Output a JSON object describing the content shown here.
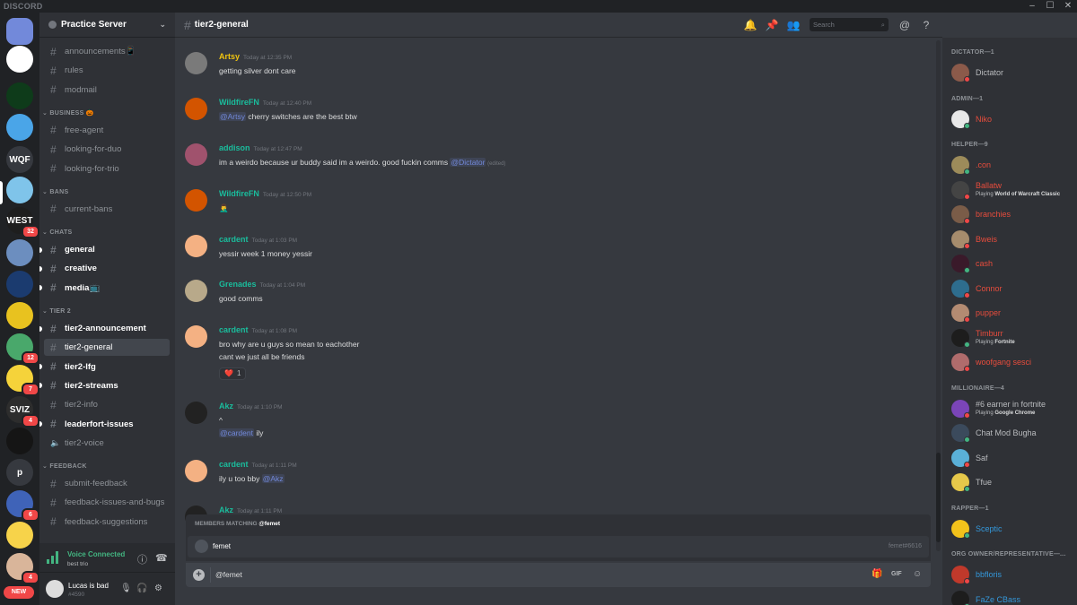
{
  "window": {
    "brand": "DISCORD",
    "controls": [
      "–",
      "☐",
      "✕"
    ]
  },
  "guilds": {
    "items": [
      {
        "label": "",
        "color": "#7289da",
        "badge": ""
      },
      {
        "label": "",
        "color": "#ffffff",
        "badge": ""
      },
      {
        "label": "",
        "color": "#0e3b1a",
        "badge": ""
      },
      {
        "label": "",
        "color": "#4aa5e8",
        "badge": ""
      },
      {
        "label": "WQF",
        "color": "#36393f",
        "badge": ""
      },
      {
        "label": "",
        "color": "#7fc4ea",
        "badge": ""
      },
      {
        "label": "WEST",
        "color": "#1e1e1e",
        "badge": "32"
      },
      {
        "label": "",
        "color": "#6c8ebf",
        "badge": ""
      },
      {
        "label": "",
        "color": "#1b3b6f",
        "badge": ""
      },
      {
        "label": "",
        "color": "#e8c21f",
        "badge": ""
      },
      {
        "label": "",
        "color": "#49a86b",
        "badge": "12"
      },
      {
        "label": "",
        "color": "#f5d33a",
        "badge": "7"
      },
      {
        "label": "SVIZ",
        "color": "#2d2d2d",
        "badge": "4"
      },
      {
        "label": "",
        "color": "#151515",
        "badge": ""
      },
      {
        "label": "p",
        "color": "#36393f",
        "badge": ""
      },
      {
        "label": "",
        "color": "#3f63b8",
        "badge": "6"
      },
      {
        "label": "",
        "color": "#f7d34a",
        "badge": ""
      },
      {
        "label": "",
        "color": "#d9b59a",
        "badge": "4"
      }
    ],
    "new_badge": "NEW"
  },
  "server": {
    "name": "Practice Server"
  },
  "channels": {
    "items": [
      {
        "type": "text",
        "label": "announcements📱",
        "state": "read"
      },
      {
        "type": "text",
        "label": "rules",
        "state": "read"
      },
      {
        "type": "text",
        "label": "modmail",
        "state": "read"
      },
      {
        "type": "category",
        "label": "BUSINESS 🎃"
      },
      {
        "type": "text",
        "label": "free-agent",
        "state": "read"
      },
      {
        "type": "text",
        "label": "looking-for-duo",
        "state": "read"
      },
      {
        "type": "text",
        "label": "looking-for-trio",
        "state": "read"
      },
      {
        "type": "category",
        "label": "BANS"
      },
      {
        "type": "text",
        "label": "current-bans",
        "state": "read"
      },
      {
        "type": "category",
        "label": "CHATS"
      },
      {
        "type": "text",
        "label": "general",
        "state": "unread"
      },
      {
        "type": "text",
        "label": "creative",
        "state": "unread"
      },
      {
        "type": "text",
        "label": "media📺",
        "state": "unread"
      },
      {
        "type": "category",
        "label": "TIER 2"
      },
      {
        "type": "text",
        "label": "tier2-announcement",
        "state": "unread"
      },
      {
        "type": "text",
        "label": "tier2-general",
        "state": "active"
      },
      {
        "type": "text",
        "label": "tier2-lfg",
        "state": "unread"
      },
      {
        "type": "text",
        "label": "tier2-streams",
        "state": "unread"
      },
      {
        "type": "text",
        "label": "tier2-info",
        "state": "read"
      },
      {
        "type": "text",
        "label": "leaderfort-issues",
        "state": "unread"
      },
      {
        "type": "voice",
        "label": "tier2-voice",
        "state": "read"
      },
      {
        "type": "category",
        "label": "FEEDBACK"
      },
      {
        "type": "text",
        "label": "submit-feedback",
        "state": "read"
      },
      {
        "type": "text",
        "label": "feedback-issues-and-bugs",
        "state": "read"
      },
      {
        "type": "text",
        "label": "feedback-suggestions",
        "state": "read"
      }
    ]
  },
  "voice": {
    "status": "Voice Connected",
    "channel": "best trio"
  },
  "user": {
    "name": "Lucas is bad",
    "tag": "#4590"
  },
  "chat": {
    "channel": "tier2-general",
    "search_placeholder": "Search",
    "messages": [
      {
        "author": "Artsy",
        "color": "#f1c40f",
        "time": "Today at 12:35 PM",
        "avatar": "#7a7a7a",
        "lines": [
          [
            {
              "t": "getting silver dont care"
            }
          ]
        ]
      },
      {
        "author": "WildfireFN",
        "color": "#1abc9c",
        "time": "Today at 12:40 PM",
        "avatar": "#d35400",
        "lines": [
          [
            {
              "t": "@Artsy",
              "m": true
            },
            {
              "t": " cherry switches are the best btw"
            }
          ]
        ]
      },
      {
        "author": "addison",
        "color": "#1abc9c",
        "time": "Today at 12:47 PM",
        "avatar": "#a0526d",
        "lines": [
          [
            {
              "t": "im a weirdo because ur buddy said im a weirdo. good fuckin comms "
            },
            {
              "t": "@Dictator",
              "m": true
            },
            {
              "t": " (edited)",
              "e": true
            }
          ]
        ]
      },
      {
        "author": "WildfireFN",
        "color": "#1abc9c",
        "time": "Today at 12:50 PM",
        "avatar": "#d35400",
        "lines": [
          [
            {
              "t": "🤦‍♂️"
            }
          ]
        ]
      },
      {
        "author": "cardent",
        "color": "#1abc9c",
        "time": "Today at 1:03 PM",
        "avatar": "#f4b183",
        "lines": [
          [
            {
              "t": "yessir week 1 money yessir"
            }
          ]
        ]
      },
      {
        "author": "Grenades",
        "color": "#1abc9c",
        "time": "Today at 1:04 PM",
        "avatar": "#b8a98a",
        "lines": [
          [
            {
              "t": "good comms"
            }
          ]
        ]
      },
      {
        "author": "cardent",
        "color": "#1abc9c",
        "time": "Today at 1:08 PM",
        "avatar": "#f4b183",
        "lines": [
          [
            {
              "t": "bro why are u guys so mean to eachother"
            }
          ],
          [
            {
              "t": "cant we just all be friends"
            }
          ]
        ],
        "reaction": {
          "emoji": "❤️",
          "count": "1"
        }
      },
      {
        "author": "Akz",
        "color": "#1abc9c",
        "time": "Today at 1:10 PM",
        "avatar": "#222222",
        "lines": [
          [
            {
              "t": "^"
            }
          ],
          [
            {
              "t": "@cardent",
              "m": true
            },
            {
              "t": " ily"
            }
          ]
        ]
      },
      {
        "author": "cardent",
        "color": "#1abc9c",
        "time": "Today at 1:11 PM",
        "avatar": "#f4b183",
        "lines": [
          [
            {
              "t": "ily u too bby "
            },
            {
              "t": "@Akz",
              "m": true
            }
          ]
        ]
      },
      {
        "author": "Akz",
        "color": "#1abc9c",
        "time": "Today at 1:11 PM",
        "avatar": "#222222",
        "lines": []
      }
    ]
  },
  "autocomplete": {
    "header_prefix": "MEMBERS MATCHING",
    "query": "@femet",
    "name": "femet",
    "tag": "femet#6616"
  },
  "composer": {
    "value": "@femet"
  },
  "members": {
    "groups": [
      {
        "label": "DICTATOR—1",
        "members": [
          {
            "name": "Dictator",
            "color": "#b9bbbe",
            "status": "#f04747",
            "avatar": "#8b5a4a"
          }
        ]
      },
      {
        "label": "ADMIN—1",
        "members": [
          {
            "name": "Niko",
            "color": "#e74c3c",
            "status": "#43b581",
            "avatar": "#e8e8e8"
          }
        ]
      },
      {
        "label": "HELPER—9",
        "members": [
          {
            "name": ".con",
            "color": "#e74c3c",
            "status": "#43b581",
            "avatar": "#9c8b5a"
          },
          {
            "name": "Ballatw",
            "color": "#e74c3c",
            "status": "#f04747",
            "avatar": "#444444",
            "activity_prefix": "Playing",
            "activity": "World of Warcraft Classic"
          },
          {
            "name": "branchies",
            "color": "#e74c3c",
            "status": "#f04747",
            "avatar": "#7a5c48"
          },
          {
            "name": "Bweis",
            "color": "#e74c3c",
            "status": "#f04747",
            "avatar": "#a68c6d"
          },
          {
            "name": "cash",
            "color": "#e74c3c",
            "status": "#43b581",
            "avatar": "#3a1a2a"
          },
          {
            "name": "Connor",
            "color": "#e74c3c",
            "status": "#f04747",
            "avatar": "#2e6d8e"
          },
          {
            "name": "pupper",
            "color": "#e74c3c",
            "status": "#f04747",
            "avatar": "#b38b72"
          },
          {
            "name": "Timburr",
            "color": "#e74c3c",
            "status": "#43b581",
            "avatar": "#1d1d1d",
            "activity_prefix": "Playing",
            "activity": "Fortnite"
          },
          {
            "name": "woofgang sesci",
            "color": "#e74c3c",
            "status": "#f04747",
            "avatar": "#b06c6c"
          }
        ]
      },
      {
        "label": "MILLIONAIRE—4",
        "members": [
          {
            "name": "#6 earner in fortnite",
            "color": "#b9bbbe",
            "status": "#f04747",
            "avatar": "#7b45b8",
            "activity_prefix": "Playing",
            "activity": "Google Chrome"
          },
          {
            "name": "Chat Mod Bugha",
            "color": "#b9bbbe",
            "status": "#43b581",
            "avatar": "#3b4a5c"
          },
          {
            "name": "Saf",
            "color": "#b9bbbe",
            "status": "#f04747",
            "avatar": "#5ab0d8"
          },
          {
            "name": "Tfue",
            "color": "#b9bbbe",
            "status": "#43b581",
            "avatar": "#e6c84a"
          }
        ]
      },
      {
        "label": "RAPPER—1",
        "members": [
          {
            "name": "Sceptic",
            "color": "#3498db",
            "status": "#43b581",
            "avatar": "#f2c21b"
          }
        ]
      },
      {
        "label": "ORG OWNER/REPRESENTATIVE—...",
        "members": [
          {
            "name": "bbfloris",
            "color": "#3498db",
            "status": "#f04747",
            "avatar": "#c0392b"
          },
          {
            "name": "FaZe CBass",
            "color": "#3498db",
            "status": "#43b581",
            "avatar": "#1d1d1d"
          }
        ]
      }
    ]
  }
}
